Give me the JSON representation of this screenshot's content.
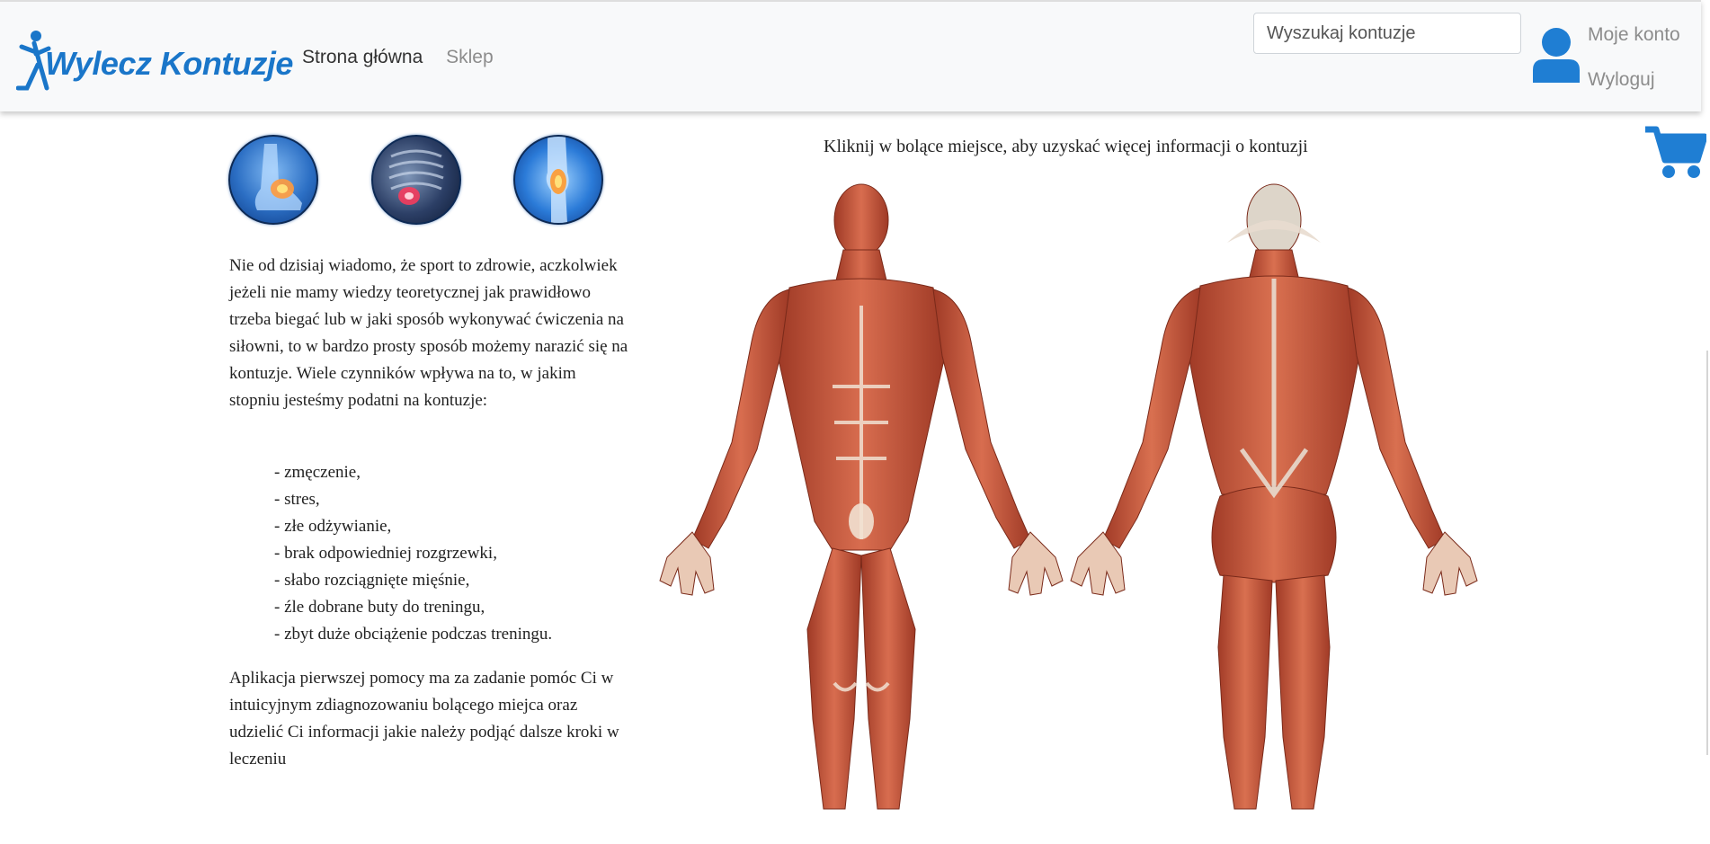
{
  "header": {
    "logo_text": "Wylecz Kontuzje",
    "nav": {
      "home": "Strona główna",
      "shop": "Sklep"
    },
    "search": {
      "placeholder": "Wyszukaj kontuzje"
    },
    "account": {
      "my_account": "Moje konto",
      "logout": "Wyloguj"
    }
  },
  "icons": {
    "user": "user-icon",
    "cart": "shopping-cart-icon",
    "ankle": "ankle-injury-icon",
    "ribs": "rib-injury-icon",
    "knee": "knee-injury-icon"
  },
  "colors": {
    "brand_blue": "#1a76c9",
    "icon_blue": "#1f7ed3",
    "nav_muted": "#8c8c8c",
    "muscle": "#c4573a"
  },
  "main": {
    "intro": "Nie od dzisiaj wiadomo, że sport to zdrowie, aczkolwiek jeżeli nie mamy wiedzy teoretycznej jak prawidłowo trzeba biegać lub w jaki sposób wykonywać ćwiczenia na siłowni, to w bardzo prosty sposób możemy narazić się na kontuzje. Wiele czynników wpływa na to, w jakim stopniu jesteśmy podatni na kontuzje:",
    "factors": [
      "- zmęczenie,",
      "- stres,",
      "- złe odżywianie,",
      "- brak odpowiedniej rozgrzewki,",
      "- słabo rozciągnięte mięśnie,",
      "- źle dobrane buty do treningu,",
      "- zbyt duże obciążenie podczas treningu."
    ],
    "outro": "Aplikacja pierwszej pomocy ma za zadanie pomóc Ci w intuicyjnym zdiagnozowaniu bolącego miejca oraz udzielić Ci informacji jakie należy podjąć dalsze kroki w leczeniu",
    "body_caption": "Kliknij w bolące miejsce, aby uzyskać więcej informacji o kontuzji"
  }
}
